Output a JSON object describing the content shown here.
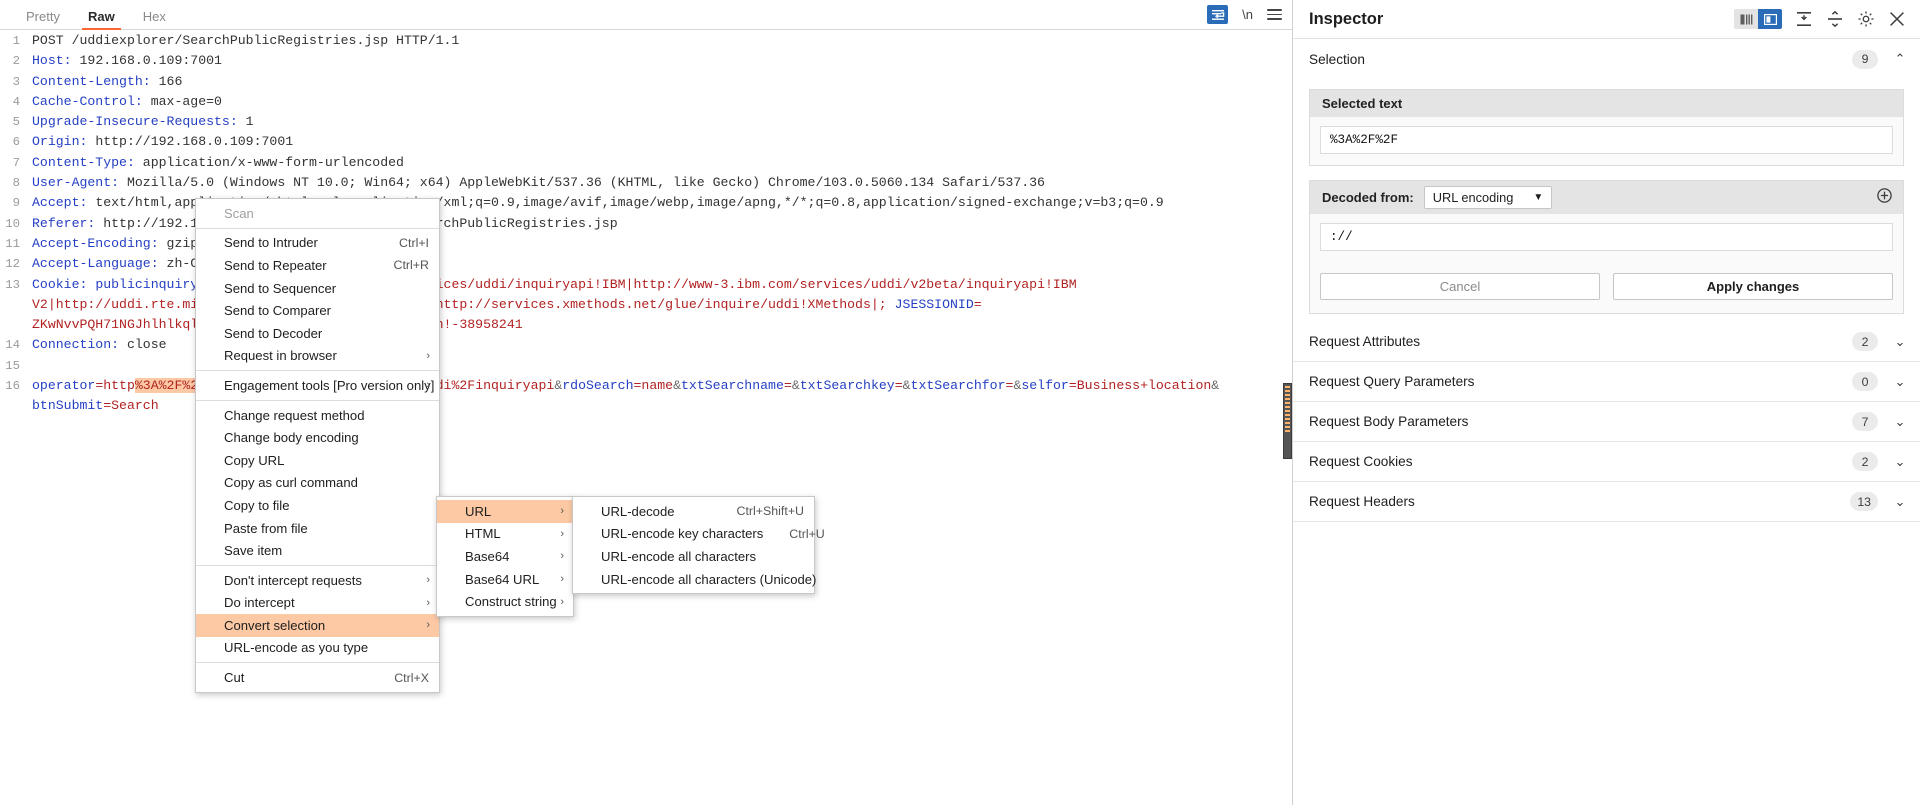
{
  "editor": {
    "tabs": [
      {
        "label": "Pretty",
        "active": false
      },
      {
        "label": "Raw",
        "active": true
      },
      {
        "label": "Hex",
        "active": false
      }
    ],
    "toolbar": {
      "wrap_icon": "word-wrap-icon",
      "newline_label": "\\n",
      "menu_icon": "hamburger-menu-icon"
    },
    "lines": [
      {
        "n": "1",
        "segs": [
          {
            "t": "POST /uddiexplorer/SearchPublicRegistries.jsp HTTP/1.1",
            "c": "d"
          }
        ]
      },
      {
        "n": "2",
        "segs": [
          {
            "t": "Host:",
            "c": "k"
          },
          {
            "t": " 192.168.0.109:7001",
            "c": "d"
          }
        ]
      },
      {
        "n": "3",
        "segs": [
          {
            "t": "Content-Length:",
            "c": "k"
          },
          {
            "t": " 166",
            "c": "d"
          }
        ]
      },
      {
        "n": "4",
        "segs": [
          {
            "t": "Cache-Control:",
            "c": "k"
          },
          {
            "t": " max-age=0",
            "c": "d"
          }
        ]
      },
      {
        "n": "5",
        "segs": [
          {
            "t": "Upgrade-Insecure-Requests:",
            "c": "k"
          },
          {
            "t": " 1",
            "c": "d"
          }
        ]
      },
      {
        "n": "6",
        "segs": [
          {
            "t": "Origin:",
            "c": "k"
          },
          {
            "t": " http://192.168.0.109:7001",
            "c": "d"
          }
        ]
      },
      {
        "n": "7",
        "segs": [
          {
            "t": "Content-Type:",
            "c": "k"
          },
          {
            "t": " application/x-www-form-urlencoded",
            "c": "d"
          }
        ]
      },
      {
        "n": "8",
        "segs": [
          {
            "t": "User-Agent:",
            "c": "k"
          },
          {
            "t": " Mozilla/5.0 (Windows NT 10.0; Win64; x64) AppleWebKit/537.36 (KHTML, like Gecko) Chrome/103.0.5060.134 Safari/537.36",
            "c": "d"
          }
        ]
      },
      {
        "n": "9",
        "segs": [
          {
            "t": "Accept:",
            "c": "k"
          },
          {
            "t": " text/html,application/xhtml+xml,application/xml;q=0.9,image/avif,image/webp,image/apng,*/*;q=0.8,application/signed-exchange;v=b3;q=0.9",
            "c": "d"
          }
        ]
      },
      {
        "n": "10",
        "segs": [
          {
            "t": "Referer:",
            "c": "k"
          },
          {
            "t": " http://192.168.0.109:7001/uddiexplorer/SearchPublicRegistries.jsp",
            "c": "d"
          }
        ]
      },
      {
        "n": "11",
        "segs": [
          {
            "t": "Accept-Encoding:",
            "c": "k"
          },
          {
            "t": " gzip, deflate",
            "c": "d"
          }
        ]
      },
      {
        "n": "12",
        "segs": [
          {
            "t": "Accept-Language:",
            "c": "k"
          },
          {
            "t": " zh-CN,zh;q=0.9",
            "c": "d"
          }
        ]
      },
      {
        "n": "13",
        "segs": [
          {
            "t": "Cookie:",
            "c": "k"
          },
          {
            "t": " publicinquiryurls",
            "c": "k"
          },
          {
            "t": "=http://www-3.ibm.com/services/uddi/inquiryapi!IBM|http://www-3.ibm.com/services/uddi/v2beta/inquiryapi!IBM",
            "c": "r"
          }
        ]
      },
      {
        "n": "",
        "segs": [
          {
            "t": "V2|http://uddi.rte.microsoft.com/inquire!Microsoft|http://services.xmethods.net/glue/inquire/uddi!XMethods|;",
            "c": "r"
          },
          {
            "t": " JSESSIONID",
            "c": "k"
          },
          {
            "t": "=",
            "c": "r"
          }
        ]
      },
      {
        "n": "",
        "segs": [
          {
            "t": "ZKwNvvPQH71NGJhlhlkqlNQmJJLnM2hxF9NQkGFnDGQTdrLTBhrn!-38958241",
            "c": "r"
          }
        ]
      },
      {
        "n": "14",
        "segs": [
          {
            "t": "Connection:",
            "c": "k"
          },
          {
            "t": " close",
            "c": "d"
          }
        ]
      },
      {
        "n": "15",
        "segs": [
          {
            "t": " ",
            "c": "d"
          }
        ]
      },
      {
        "n": "16",
        "segs": [
          {
            "t": "operator",
            "c": "k"
          },
          {
            "t": "=http",
            "c": "r"
          },
          {
            "t": "%3A%2F%2F",
            "c": "sel"
          },
          {
            "t": "www-3.ibm.com%2Fservices%2Fuddi%2Finquiryapi",
            "c": "r"
          },
          {
            "t": "&",
            "c": "amp"
          },
          {
            "t": "rdoSearch",
            "c": "k"
          },
          {
            "t": "=name",
            "c": "r"
          },
          {
            "t": "&",
            "c": "amp"
          },
          {
            "t": "txtSearchname",
            "c": "k"
          },
          {
            "t": "=",
            "c": "r"
          },
          {
            "t": "&",
            "c": "amp"
          },
          {
            "t": "txtSearchkey",
            "c": "k"
          },
          {
            "t": "=",
            "c": "r"
          },
          {
            "t": "&",
            "c": "amp"
          },
          {
            "t": "txtSearchfor",
            "c": "k"
          },
          {
            "t": "=",
            "c": "r"
          },
          {
            "t": "&",
            "c": "amp"
          },
          {
            "t": "selfor",
            "c": "k"
          },
          {
            "t": "=Business+location",
            "c": "r"
          },
          {
            "t": "&",
            "c": "amp"
          }
        ]
      },
      {
        "n": "",
        "segs": [
          {
            "t": "btnSubmit",
            "c": "k"
          },
          {
            "t": "=Search",
            "c": "r"
          }
        ]
      }
    ]
  },
  "context_menu": {
    "items": [
      {
        "label": "Scan",
        "accel": "",
        "disabled": true,
        "submenu": false,
        "highlight": false
      },
      {
        "sep": true
      },
      {
        "label": "Send to Intruder",
        "accel": "Ctrl+I",
        "disabled": false,
        "submenu": false,
        "highlight": false
      },
      {
        "label": "Send to Repeater",
        "accel": "Ctrl+R",
        "disabled": false,
        "submenu": false,
        "highlight": false
      },
      {
        "label": "Send to Sequencer",
        "accel": "",
        "disabled": false,
        "submenu": false,
        "highlight": false
      },
      {
        "label": "Send to Comparer",
        "accel": "",
        "disabled": false,
        "submenu": false,
        "highlight": false
      },
      {
        "label": "Send to Decoder",
        "accel": "",
        "disabled": false,
        "submenu": false,
        "highlight": false
      },
      {
        "label": "Request in browser",
        "accel": "",
        "disabled": false,
        "submenu": true,
        "highlight": false
      },
      {
        "sep": true
      },
      {
        "label": "Engagement tools [Pro version only]",
        "accel": "",
        "disabled": false,
        "submenu": true,
        "highlight": false
      },
      {
        "sep": true
      },
      {
        "label": "Change request method",
        "accel": "",
        "disabled": false,
        "submenu": false,
        "highlight": false
      },
      {
        "label": "Change body encoding",
        "accel": "",
        "disabled": false,
        "submenu": false,
        "highlight": false
      },
      {
        "label": "Copy URL",
        "accel": "",
        "disabled": false,
        "submenu": false,
        "highlight": false
      },
      {
        "label": "Copy as curl command",
        "accel": "",
        "disabled": false,
        "submenu": false,
        "highlight": false
      },
      {
        "label": "Copy to file",
        "accel": "",
        "disabled": false,
        "submenu": false,
        "highlight": false
      },
      {
        "label": "Paste from file",
        "accel": "",
        "disabled": false,
        "submenu": false,
        "highlight": false
      },
      {
        "label": "Save item",
        "accel": "",
        "disabled": false,
        "submenu": false,
        "highlight": false
      },
      {
        "sep": true
      },
      {
        "label": "Don't intercept requests",
        "accel": "",
        "disabled": false,
        "submenu": true,
        "highlight": false
      },
      {
        "label": "Do intercept",
        "accel": "",
        "disabled": false,
        "submenu": true,
        "highlight": false
      },
      {
        "label": "Convert selection",
        "accel": "",
        "disabled": false,
        "submenu": true,
        "highlight": true
      },
      {
        "label": "URL-encode as you type",
        "accel": "",
        "disabled": false,
        "submenu": false,
        "highlight": false
      },
      {
        "sep": true
      },
      {
        "label": "Cut",
        "accel": "Ctrl+X",
        "disabled": false,
        "submenu": false,
        "highlight": false
      }
    ],
    "convert_submenu": [
      {
        "label": "URL",
        "submenu": true,
        "highlight": true
      },
      {
        "label": "HTML",
        "submenu": true,
        "highlight": false
      },
      {
        "label": "Base64",
        "submenu": true,
        "highlight": false
      },
      {
        "label": "Base64 URL",
        "submenu": true,
        "highlight": false
      },
      {
        "label": "Construct string",
        "submenu": true,
        "highlight": false
      }
    ],
    "url_submenu": [
      {
        "label": "URL-decode",
        "accel": "Ctrl+Shift+U",
        "highlight": false
      },
      {
        "label": "URL-encode key characters",
        "accel": "Ctrl+U",
        "highlight": false
      },
      {
        "label": "URL-encode all characters",
        "accel": "",
        "highlight": false
      },
      {
        "label": "URL-encode all characters (Unicode)",
        "accel": "",
        "highlight": false
      }
    ]
  },
  "inspector": {
    "title": "Inspector",
    "tools": {
      "layout_split_icon": "layout-split-icon",
      "layout_single_icon": "layout-single-icon",
      "collapse_all_icon": "collapse-all-icon",
      "expand_all_icon": "expand-all-icon",
      "settings_icon": "gear-icon",
      "close_icon": "close-icon"
    },
    "selection": {
      "title": "Selection",
      "count": "9",
      "chevron": "⌃",
      "selected_text_label": "Selected text",
      "selected_text_value": "%3A%2F%2F",
      "decoded_from_label": "Decoded from:",
      "decoded_from_value": "URL encoding",
      "decoded_value": "://",
      "cancel_label": "Cancel",
      "apply_label": "Apply changes"
    },
    "sections": [
      {
        "label": "Request Attributes",
        "count": "2"
      },
      {
        "label": "Request Query Parameters",
        "count": "0"
      },
      {
        "label": "Request Body Parameters",
        "count": "7"
      },
      {
        "label": "Request Cookies",
        "count": "2"
      },
      {
        "label": "Request Headers",
        "count": "13"
      }
    ]
  }
}
